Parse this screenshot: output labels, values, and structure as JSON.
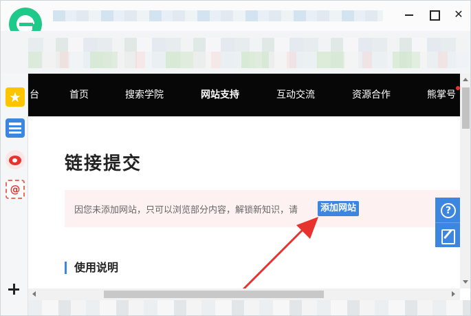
{
  "browser": {
    "logo": "browser-e-logo",
    "window_controls": [
      "minimize",
      "maximize",
      "close"
    ]
  },
  "sidebar": {
    "items": [
      {
        "icon": "star-icon",
        "label": "favorites"
      },
      {
        "icon": "news-icon",
        "label": "news"
      },
      {
        "icon": "weibo-icon",
        "label": "weibo"
      },
      {
        "icon": "mail-icon",
        "label": "mail"
      },
      {
        "icon": "plus-icon",
        "label": "add"
      }
    ]
  },
  "nav": {
    "items": [
      {
        "label": "台",
        "active": false
      },
      {
        "label": "首页",
        "active": false
      },
      {
        "label": "搜索学院",
        "active": false
      },
      {
        "label": "网站支持",
        "active": true
      },
      {
        "label": "互动交流",
        "active": false
      },
      {
        "label": "资源合作",
        "active": false
      },
      {
        "label": "熊掌号",
        "active": false
      }
    ]
  },
  "page": {
    "title": "链接提交",
    "notice": "因您未添加网站，只可以浏览部分内容，解锁新知识，请",
    "notice_button": "添加网站",
    "section_heading": "使用说明"
  },
  "colors": {
    "accent": "#3d86e0",
    "nav_bg": "#070707",
    "notice_bg": "#fdf1f1",
    "arrow": "#e8322e",
    "logo": "#1ec98a"
  }
}
